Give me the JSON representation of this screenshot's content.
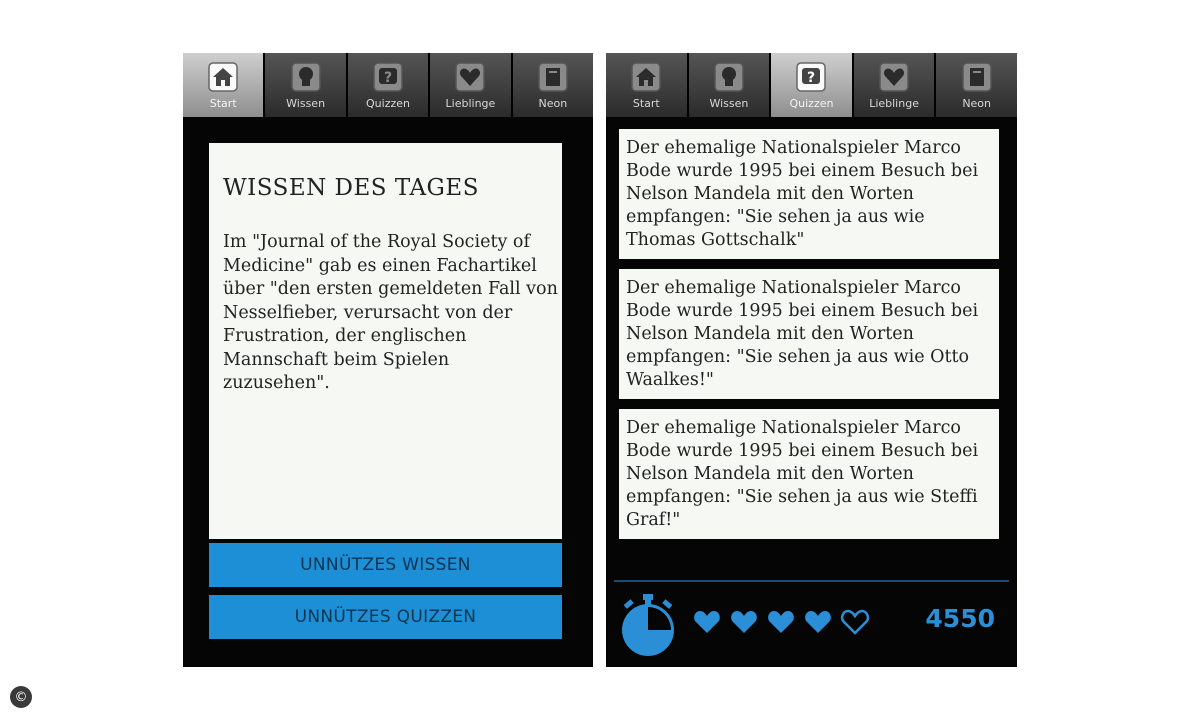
{
  "tabs": [
    {
      "label": "Start",
      "icon": "home-icon"
    },
    {
      "label": "Wissen",
      "icon": "lightbulb-icon"
    },
    {
      "label": "Quizzen",
      "icon": "question-icon"
    },
    {
      "label": "Lieblinge",
      "icon": "heart-icon"
    },
    {
      "label": "Neon",
      "icon": "book-icon"
    }
  ],
  "left_screen": {
    "active_tab": "Start",
    "card_title": "WISSEN DES TAGES",
    "card_text": "Im \"Journal of the Royal Society of Medicine\" gab es einen Fachartikel über \"den ersten gemeldeten Fall von Nesselfieber, verursacht von der Frustration, der englischen Mannschaft beim Spielen zuzusehen\".",
    "button_wissen": "UNNÜTZES WISSEN",
    "button_quizzen": "UNNÜTZES QUIZZEN"
  },
  "right_screen": {
    "active_tab": "Quizzen",
    "answers": [
      "Der ehemalige Nationalspieler Marco Bode wurde 1995 bei einem Besuch bei Nelson Mandela mit den Worten empfangen: \"Sie sehen ja aus wie Thomas Gottschalk\"",
      "Der ehemalige Nationalspieler Marco Bode wurde 1995 bei einem Besuch bei Nelson Mandela mit den Worten empfangen: \"Sie sehen ja aus wie Otto Waalkes!\"",
      "Der ehemalige Nationalspieler Marco Bode wurde 1995 bei einem Besuch bei Nelson Mandela mit den Worten empfangen: \"Sie sehen ja aus wie Steffi Graf!\""
    ],
    "lives_total": 5,
    "lives_remaining": 4,
    "score": "4550",
    "accent_color": "#2a8fd6"
  },
  "copyright_symbol": "©"
}
